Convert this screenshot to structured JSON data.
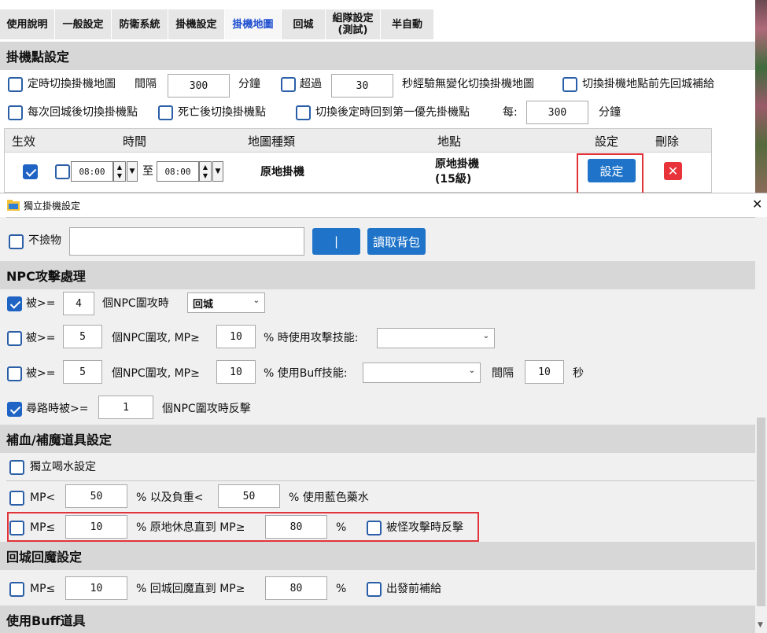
{
  "tabs": [
    {
      "label": "使用說明",
      "active": false
    },
    {
      "label": "一般設定",
      "active": false
    },
    {
      "label": "防衛系統",
      "active": false
    },
    {
      "label": "掛機設定",
      "active": false
    },
    {
      "label": "掛機地圖",
      "active": true
    },
    {
      "label": "回城",
      "active": false
    },
    {
      "label": "組隊設定\n(測試)",
      "active": false
    },
    {
      "label": "半自動",
      "active": false
    }
  ],
  "hangPoint": {
    "header": "掛機點設定",
    "row1": {
      "timedSwitch": "定時切換掛機地圖",
      "interval": "間隔",
      "intervalValue": "300",
      "minutes": "分鐘",
      "exceed": "超過",
      "exceedValue": "30",
      "noChange": "秒經驗無變化切換掛機地圖",
      "returnBeforeSwitch": "切換掛機地點前先回城補給"
    },
    "row2": {
      "switchAfterReturn": "每次回城後切換掛機點",
      "switchAfterDeath": "死亡後切換掛機點",
      "backToFirst": "切換後定時回到第一優先掛機點",
      "every": "每:",
      "everyValue": "300",
      "minutes": "分鐘"
    },
    "grid": {
      "headers": [
        "生效",
        "時間",
        "地圖種類",
        "地點",
        "設定",
        "刪除"
      ],
      "row": {
        "enabled": true,
        "timeFrom": "08:00",
        "to": "至",
        "timeTo": "08:00",
        "mapType": "原地掛機",
        "location": "原地掛機\n(15級)",
        "settingButton": "設定",
        "deleteIcon": "✕"
      }
    }
  },
  "dialog": {
    "title": "獨立掛機設定",
    "close": "✕",
    "noPickup": {
      "label": "不撿物",
      "value": "",
      "pipeButton": "|",
      "readBag": "讀取背包"
    },
    "npc": {
      "header": "NPC攻擊處理",
      "row1": {
        "checked": true,
        "prefix": "被>=",
        "value": "4",
        "suffix": "個NPC圍攻時",
        "select": "回城"
      },
      "row2": {
        "checked": false,
        "prefix": "被>=",
        "value": "5",
        "mid": "個NPC圍攻, MP≥",
        "mp": "10",
        "suffix": "% 時使用攻擊技能:",
        "select": ""
      },
      "row3": {
        "checked": false,
        "prefix": "被>=",
        "value": "5",
        "mid": "個NPC圍攻, MP≥",
        "mp": "10",
        "suffix": "% 使用Buff技能:",
        "select": "",
        "interval": "間隔",
        "intervalValue": "10",
        "seconds": "秒"
      },
      "row4": {
        "checked": true,
        "prefix": "尋路時被>=",
        "value": "1",
        "suffix": "個NPC圍攻時反擊"
      }
    },
    "recovery": {
      "header": "補血/補魔道具設定",
      "independent": "獨立喝水設定",
      "mpRow": {
        "prefix": "MP<",
        "value": "50",
        "mid": "% 以及負重<",
        "weight": "50",
        "suffix": "% 使用藍色藥水"
      },
      "restRow": {
        "prefix": "MP≤",
        "value": "10",
        "mid": "% 原地休息直到 MP≥",
        "target": "80",
        "pct": "%",
        "counter": "被怪攻擊時反擊"
      }
    },
    "returnMp": {
      "header": "回城回魔設定",
      "row": {
        "prefix": "MP≤",
        "value": "10",
        "mid": "% 回城回魔直到 MP≥",
        "target": "80",
        "pct": "%",
        "supply": "出發前補給"
      }
    },
    "buffItems": {
      "header": "使用Buff道具"
    }
  },
  "colors": {
    "accent": "#1f74c9",
    "highlight": "#e0333a",
    "sectionHeader": "#d7d7d7"
  }
}
